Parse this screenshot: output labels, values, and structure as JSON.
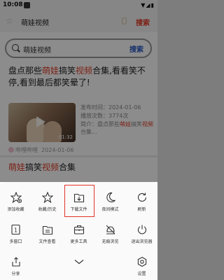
{
  "status_bar": {
    "time": "10:08"
  },
  "top_bar": {
    "query": "萌娃视频",
    "search_button": "搜索"
  },
  "search": {
    "value": "萌娃视频",
    "button": "搜索"
  },
  "result1": {
    "title_a": "盘点那些",
    "title_b": "萌娃",
    "title_c": "搞笑",
    "title_d": "视频",
    "title_e": "合集,看看笑不停,看到最后都笑晕了!",
    "published": "发布时间：2024-01-06",
    "plays": "播放次数：3774次",
    "intro_a": "简介：盘点那些",
    "intro_b": "萌娃",
    "intro_c": "搞笑",
    "intro_d": "视频",
    "intro_e": "合集...",
    "duration": "01:32",
    "source": "哔哩哔哩",
    "source_date": "2024-01-06"
  },
  "result2": {
    "a": "萌娃",
    "b": "搞笑",
    "c": "视频",
    "d": "合集"
  },
  "menu": {
    "row1": [
      {
        "label": "添加收藏",
        "icon": "star-plus-icon"
      },
      {
        "label": "收藏/历史",
        "icon": "star-icon"
      },
      {
        "label": "下载文件",
        "icon": "download-folder-icon"
      },
      {
        "label": "夜间模式",
        "icon": "moon-icon"
      },
      {
        "label": "刷新",
        "icon": "refresh-icon"
      }
    ],
    "row2": [
      {
        "label": "多窗口",
        "icon": "multi-window-icon"
      },
      {
        "label": "文件查看",
        "icon": "file-view-icon"
      },
      {
        "label": "更多工具",
        "icon": "toolbox-icon"
      },
      {
        "label": "无痕浏览",
        "icon": "no-trace-icon"
      },
      {
        "label": "退出浏览器",
        "icon": "power-icon"
      }
    ],
    "bottom": [
      {
        "label": "分享",
        "icon": "share-icon"
      },
      {
        "label": "",
        "icon": "chevron-down-icon"
      },
      {
        "label": "设置",
        "icon": "settings-icon"
      }
    ]
  },
  "colors": {
    "accent_red": "#e03b26",
    "search_blue": "#2a59c4",
    "highlight_box": "#e0352a"
  }
}
